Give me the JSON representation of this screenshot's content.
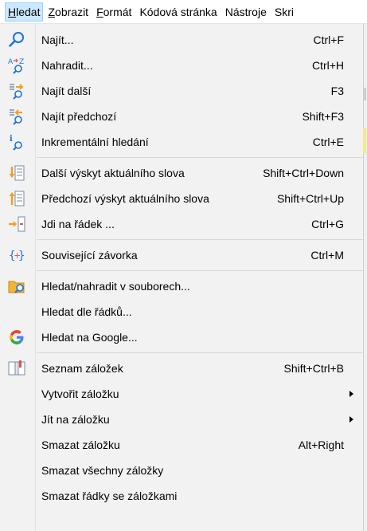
{
  "menubar": {
    "items": [
      {
        "mnemonic": "H",
        "rest": "ledat"
      },
      {
        "mnemonic": "Z",
        "rest": "obrazit"
      },
      {
        "mnemonic": "F",
        "rest": "ormát"
      },
      {
        "label": "Kódová stránka"
      },
      {
        "label": "Nástroje"
      },
      {
        "label": "Skri"
      }
    ]
  },
  "menu": {
    "find": {
      "label": "Najít...",
      "shortcut": "Ctrl+F"
    },
    "replace": {
      "label": "Nahradit...",
      "shortcut": "Ctrl+H"
    },
    "find_next": {
      "label": "Najít další",
      "shortcut": "F3"
    },
    "find_prev": {
      "label": "Najít předchozí",
      "shortcut": "Shift+F3"
    },
    "incremental": {
      "label": "Inkrementální hledání",
      "shortcut": "Ctrl+E"
    },
    "next_word": {
      "label": "Další výskyt aktuálního slova",
      "shortcut": "Shift+Ctrl+Down"
    },
    "prev_word": {
      "label": "Předchozí výskyt aktuálního slova",
      "shortcut": "Shift+Ctrl+Up"
    },
    "goto_line": {
      "label": "Jdi na řádek ...",
      "shortcut": "Ctrl+G"
    },
    "matching_brace": {
      "label": "Související závorka",
      "shortcut": "Ctrl+M"
    },
    "find_in_files": {
      "label": "Hledat/nahradit v souborech..."
    },
    "find_by_lines": {
      "label": "Hledat dle řádků..."
    },
    "google": {
      "label": "Hledat na Google..."
    },
    "bookmark_list": {
      "label": "Seznam záložek",
      "shortcut": "Shift+Ctrl+B"
    },
    "create_bookmark": {
      "label": "Vytvořit záložku"
    },
    "goto_bookmark": {
      "label": "Jít na záložku"
    },
    "delete_bookmark": {
      "label": "Smazat záložku",
      "shortcut": "Alt+Right"
    },
    "delete_all_bookmarks": {
      "label": "Smazat všechny záložky"
    },
    "delete_bookmarked_lines": {
      "label": "Smazat řádky se záložkami"
    }
  },
  "colors": {
    "accent_blue": "#1e72d6",
    "highlight": "#cce8ff",
    "google_red": "#ea4335",
    "yellow": "#f5c518"
  }
}
